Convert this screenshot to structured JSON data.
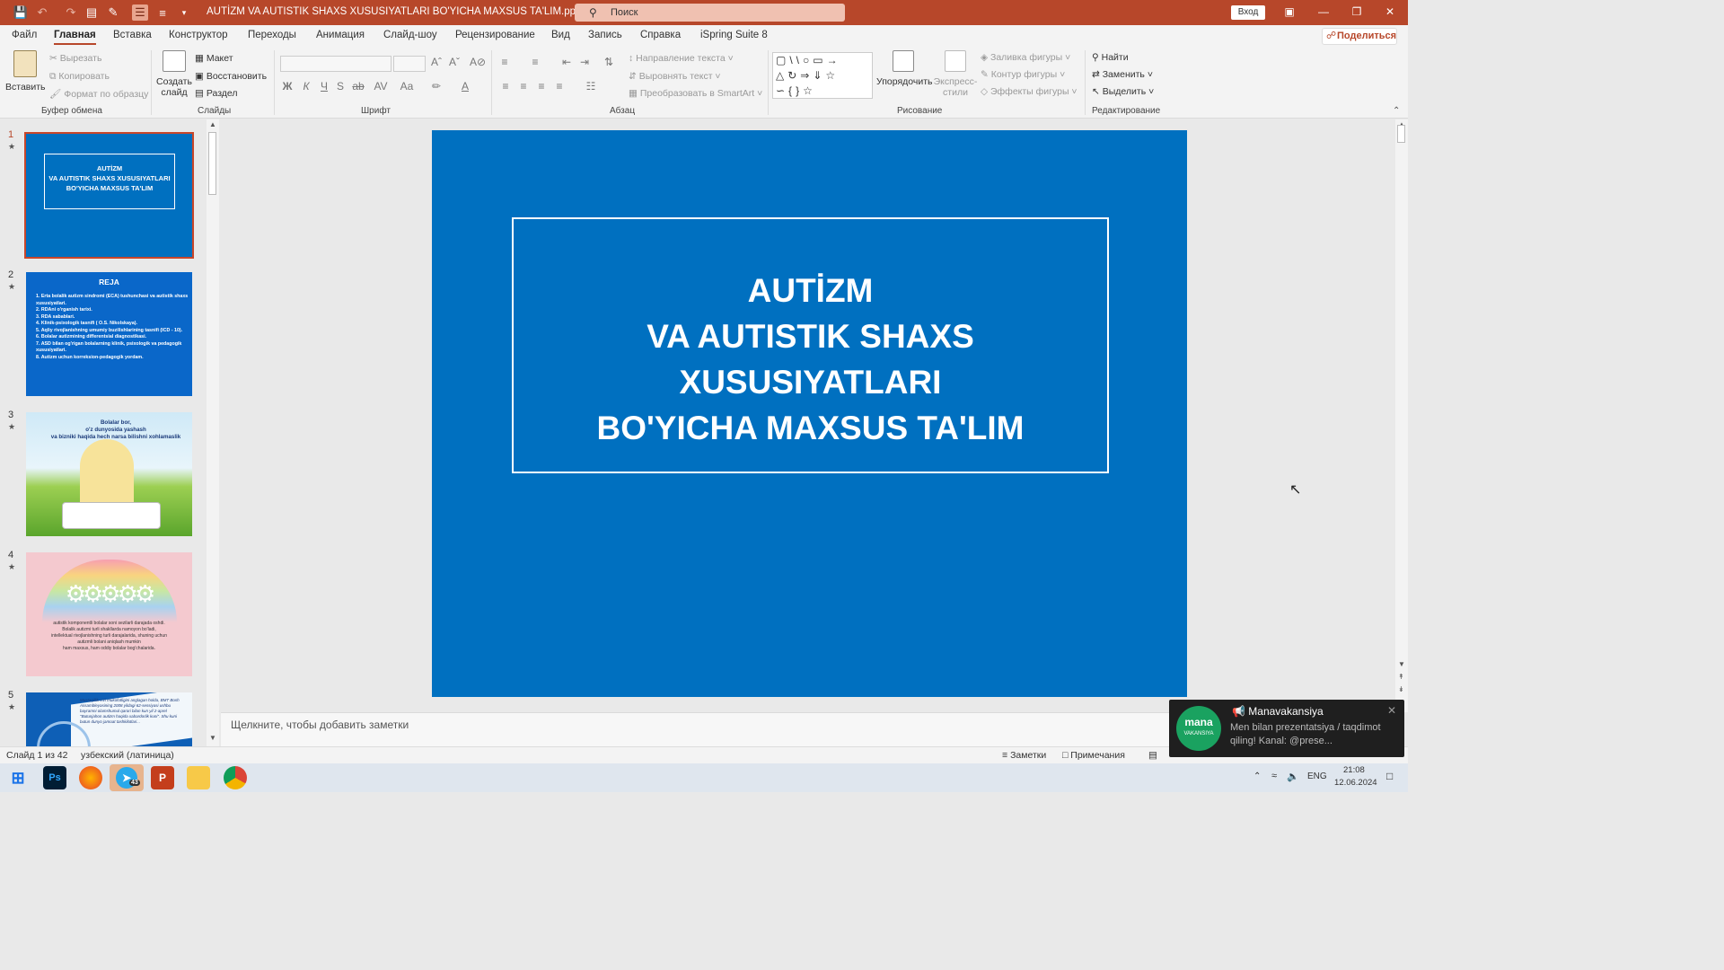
{
  "window": {
    "doc_title": "AUTİZM VA AUTISTIK SHAXS XUSUSIYATLARI BO'YICHA MAXSUS TA'LIM.pptx  -  PowerPoint",
    "search_placeholder": "Поиск",
    "signin": "Вход"
  },
  "menu": {
    "tabs": [
      "Файл",
      "Главная",
      "Вставка",
      "Конструктор",
      "Переходы",
      "Анимация",
      "Слайд-шоу",
      "Рецензирование",
      "Вид",
      "Запись",
      "Справка",
      "iSpring Suite 8"
    ],
    "share": "Поделиться"
  },
  "ribbon": {
    "clipboard": {
      "paste": "Вставить",
      "cut": "Вырезать",
      "copy": "Копировать",
      "format_painter": "Формат по образцу",
      "label": "Буфер обмена"
    },
    "slides": {
      "new_slide_1": "Создать",
      "new_slide_2": "слайд",
      "layout": "Макет",
      "reset": "Восстановить",
      "section": "Раздел",
      "label": "Слайды"
    },
    "font": {
      "label": "Шрифт",
      "bold": "Ж",
      "italic": "К",
      "underline": "Ч",
      "strike": "S",
      "strike2": "ab",
      "spacing": "AV",
      "case": "Aa"
    },
    "paragraph": {
      "text_direction": "Направление текста",
      "align_text": "Выровнять текст",
      "smartart": "Преобразовать в SmartArt",
      "label": "Абзац"
    },
    "drawing": {
      "arrange": "Упорядочить",
      "quick_styles_1": "Экспресс-",
      "quick_styles_2": "стили",
      "fill": "Заливка фигуры",
      "outline": "Контур фигуры",
      "effects": "Эффекты фигуры",
      "label": "Рисование"
    },
    "editing": {
      "find": "Найти",
      "replace": "Заменить",
      "select": "Выделить",
      "label": "Редактирование"
    }
  },
  "thumbnails": [
    {
      "num": "1",
      "title": "AUTİZM\nVA AUTISTIK SHAXS XUSUSIYATLARI\nBO'YICHA MAXSUS TA'LIM"
    },
    {
      "num": "2",
      "title": "REJA",
      "items": "1. Erta bolalik autizm sindromi (ECA) tushunchasi va autistik shaxs xususiyatlari.\n2. RDAni o'rganish tarixi.\n3. RDA sabablari.\n4. Klinik-psixologik tasnifi ( O.S. Nikolskaya).\n5. Aqliy rivojlanishning umumiy buzilishlarining tasnifi (ICD - 10).\n6. Bolalar autizmining differentsial diagnostikasi.\n7. ASD bilan og'rigan bolalarning klinik, psixologik va pedagogik xususiyatlari.\n8. Autizm uchun korreksion-pedagogik yordam."
    },
    {
      "num": "3",
      "title": "Bolalar bor,\no'z dunyosida yashash\nva bizniki haqida hech narsa bilishni xohlamaslik"
    },
    {
      "num": "4",
      "title": "autistik komponentli bolalar soni sezilarli darajada oshdi.\nBolalik autizmi turli shakllarda namoyon bo'ladi,\nintellektual rivojlanishning turli darajalarida, shuning uchun\nautizmli bolani aniqlash mumkin\nham maxsus, ham oddiy bolalar bog'chalarida."
    },
    {
      "num": "5",
      "title": "Mustaqillik o'zi mukofotligini anglagan holda, BMT Bosh Assambleyasining 2008 yildagi 62-sessiyasi ushbu bayramni olamshumul qarori bilan kun yil 2-aprel \"Butunjahon autizm haqida xabardorlik kuni\". Shu kuni butun dunyo jamoat tashkilotlari..."
    }
  ],
  "slide": {
    "title": "AUTİZM\nVA AUTISTIK SHAXS XUSUSIYATLARI\nBO'YICHA MAXSUS TA'LIM"
  },
  "notes": {
    "placeholder": "Щелкните, чтобы добавить заметки"
  },
  "status": {
    "slide_count": "Слайд 1 из 42",
    "language": "узбекский (латиница)",
    "notes_btn": "Заметки",
    "comments_btn": "Примечания"
  },
  "toast": {
    "title": "📢 Manavakansiya",
    "message": "Men bilan prezentatsiya / taqdimot qiling! Kanal: @prese...",
    "logo_main": "mana",
    "logo_sub": "VAKANSIYA"
  },
  "taskbar": {
    "lang": "ENG",
    "time": "21:08",
    "date": "12.06.2024",
    "telegram_badge": "43"
  },
  "colors": {
    "accent": "#b7472a",
    "slide_bg": "#0070c0"
  }
}
